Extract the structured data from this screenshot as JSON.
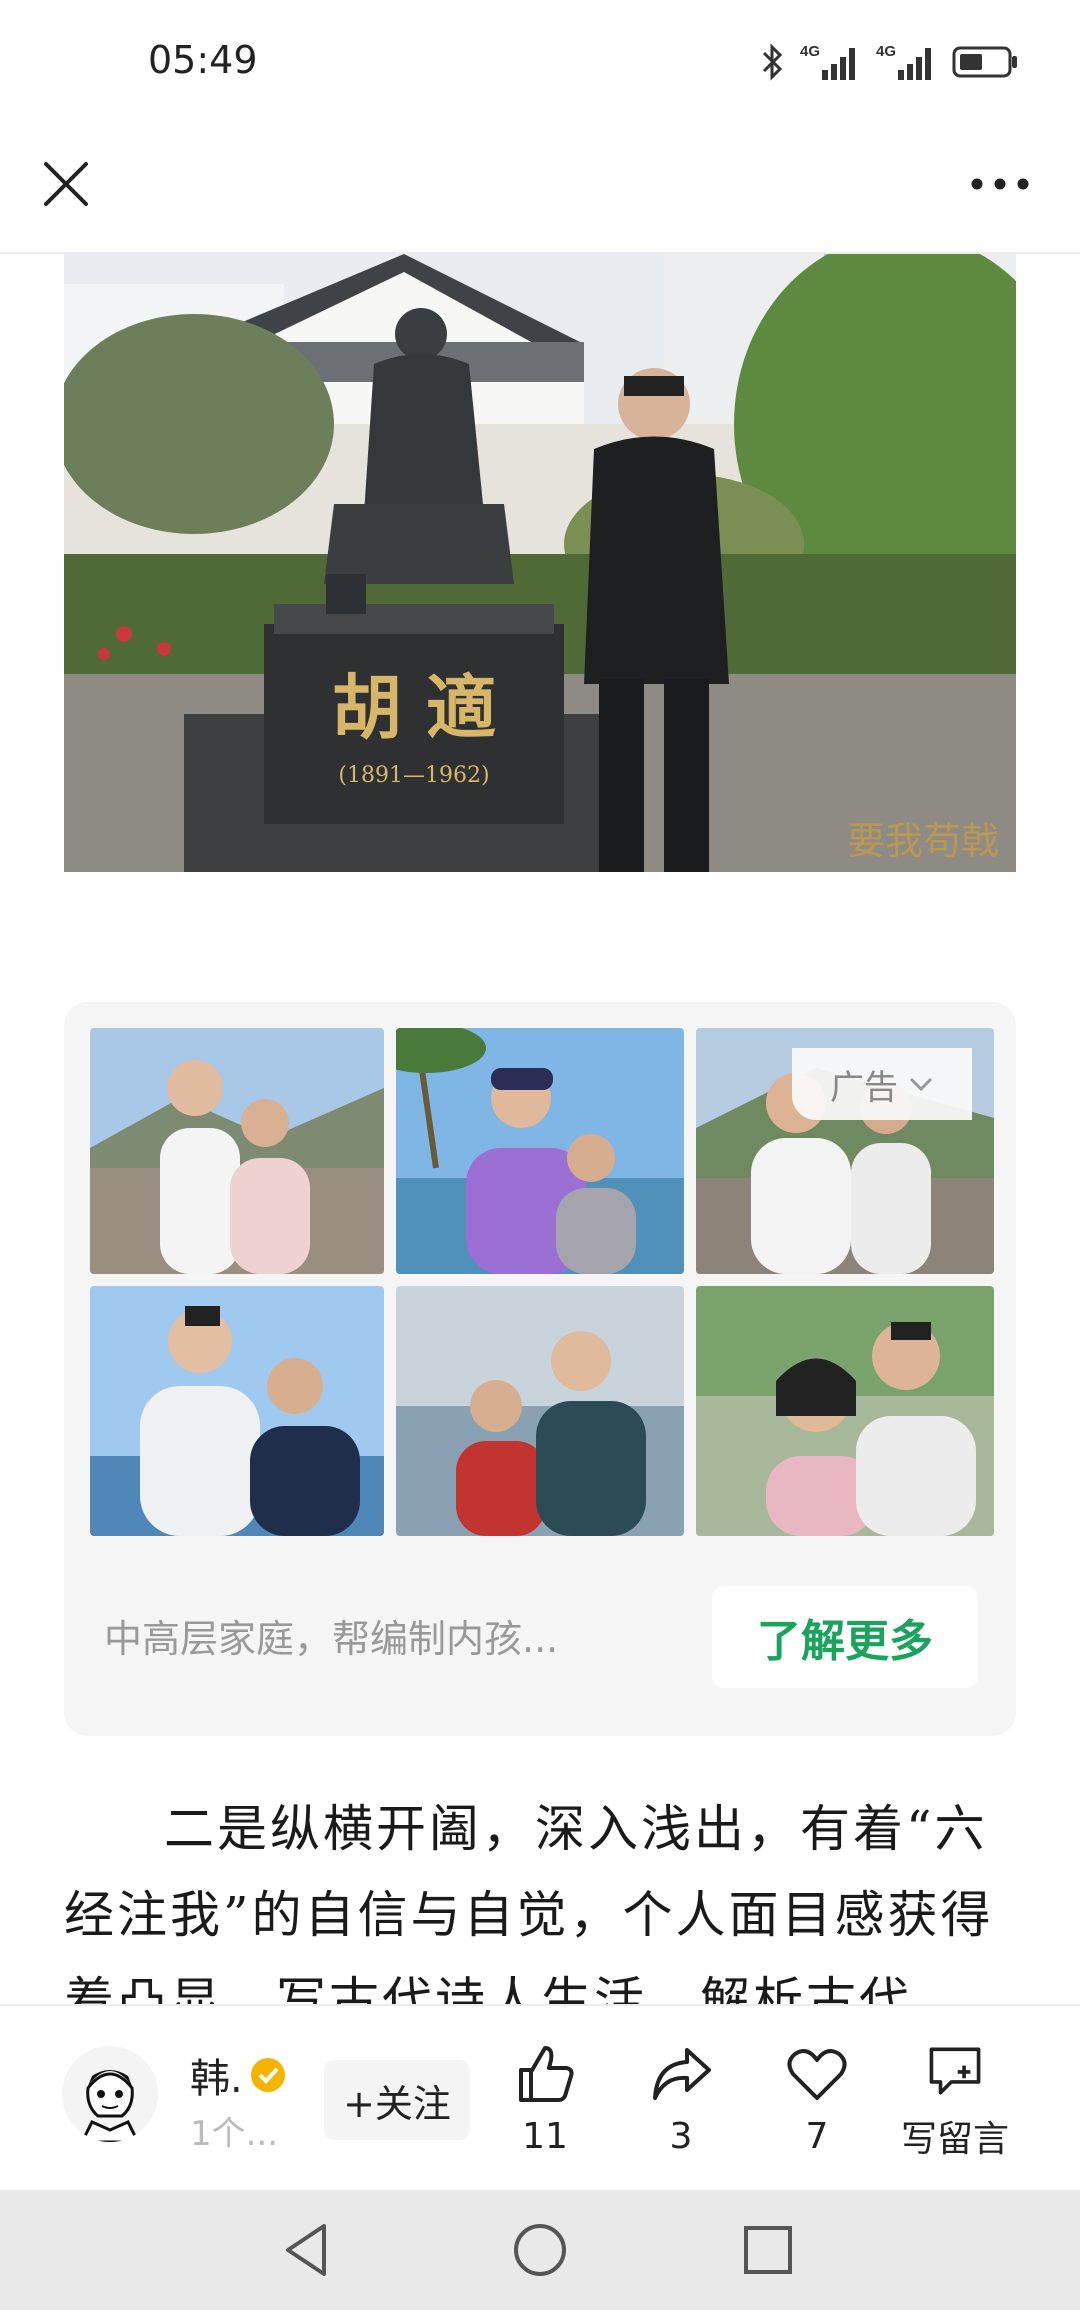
{
  "status_bar": {
    "time": "05:49",
    "icons": [
      "bluetooth-icon",
      "signal-4g-icon",
      "signal-4g-icon",
      "battery-icon"
    ],
    "network_label_1": "4G",
    "network_label_2": "4G"
  },
  "nav": {
    "close_icon": "close-icon",
    "more_icon": "more-icon"
  },
  "hero": {
    "statue_name": "胡 適",
    "statue_years": "(1891—1962)",
    "watermark": "要我苟戟"
  },
  "ad": {
    "label": "广告",
    "description": "中高层家庭，帮编制内孩...",
    "cta": "了解更多"
  },
  "article": {
    "paragraph": "二是纵横开阖，深入浅出，有着“六经注我”的自信与自觉，个人面目感获得着凸显。写古代诗人生活，解析古代"
  },
  "bottom_bar": {
    "author_name": "韩.",
    "author_sub": "1个...",
    "follow_label": "+关注",
    "like_count": "11",
    "share_count": "3",
    "favorite_count": "7",
    "comment_label": "写留言"
  },
  "colors": {
    "accent_green": "#1aa35c",
    "verified_gold": "#f5b400"
  }
}
